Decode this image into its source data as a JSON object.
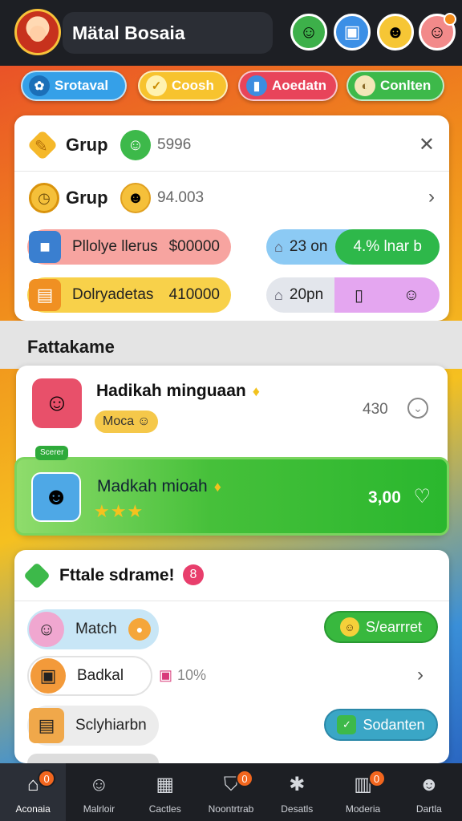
{
  "header": {
    "title": "Mätal Bosaia",
    "icons": [
      "character-icon",
      "gift-box-icon",
      "smiley-icon",
      "profile-icon"
    ]
  },
  "chips": [
    {
      "label": "Srotaval",
      "icon": "ribbon-icon"
    },
    {
      "label": "Coosh",
      "icon": "check-icon"
    },
    {
      "label": "Aoedatn",
      "icon": "cards-icon"
    },
    {
      "label": "Conlten",
      "icon": "cookie-icon"
    }
  ],
  "card1": {
    "row1": {
      "label": "Grup",
      "value": "5996"
    },
    "row2": {
      "label": "Grup",
      "value": "94.003"
    },
    "stat1": {
      "name": "Pllolye llerus",
      "amount": "$00000"
    },
    "stat2": {
      "name": "Dolryadetas",
      "amount": "410000"
    },
    "stat3": {
      "value": "23 on",
      "badge": "4.% lnar b"
    },
    "stat4": {
      "value": "20pn"
    }
  },
  "section": {
    "title": "Fattakame"
  },
  "list": {
    "item1": {
      "title": "Hadikah minguaan",
      "tag": "Moca",
      "value": "430"
    },
    "item2": {
      "title": "Madkah mioah",
      "value": "3,00",
      "tag": "Scerer",
      "stars": "★★★",
      "rating": 3
    }
  },
  "card3": {
    "title": "Fttale sdrame!",
    "badge": "8",
    "games": [
      {
        "name": "Match"
      },
      {
        "name": "Badkal",
        "percent": "10%"
      },
      {
        "name": "Sclyhiarbn"
      }
    ],
    "actions": {
      "primary": "S/earrret",
      "secondary": "Sodanten"
    }
  },
  "nav": [
    {
      "label": "Aconaia",
      "badge": "0",
      "icon": "home-icon"
    },
    {
      "label": "Malrloir",
      "badge": "",
      "icon": "chat-icon"
    },
    {
      "label": "Cactles",
      "badge": "",
      "icon": "tasks-icon"
    },
    {
      "label": "Noontrtrab",
      "badge": "0",
      "icon": "shield-icon"
    },
    {
      "label": "Desatls",
      "badge": "",
      "icon": "gear-icon"
    },
    {
      "label": "Moderia",
      "badge": "0",
      "icon": "calendar-icon"
    },
    {
      "label": "Dartla",
      "badge": "",
      "icon": "user-icon"
    }
  ],
  "colors": {
    "accent_green": "#3db94a",
    "accent_orange": "#f2661e",
    "bar_dark": "#1d1f24"
  }
}
